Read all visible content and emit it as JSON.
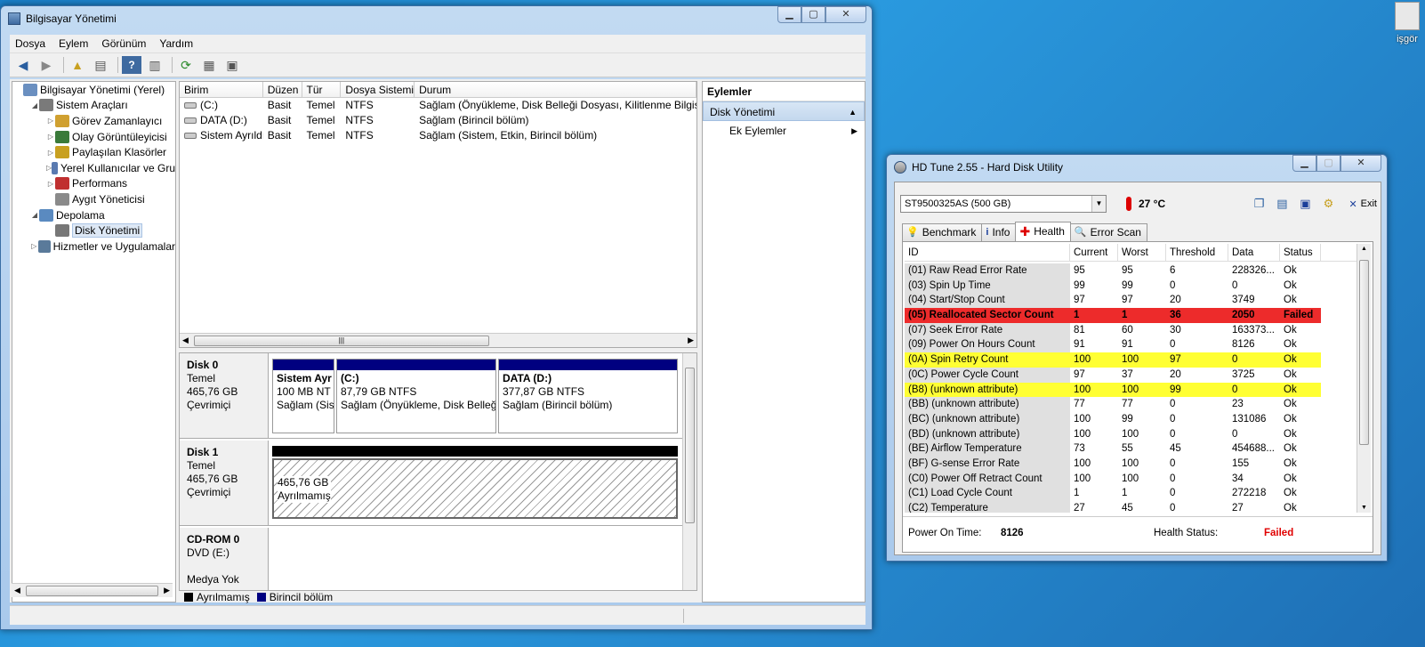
{
  "desktop": {
    "icon_label": "işgör"
  },
  "mmc": {
    "title": "Bilgisayar Yönetimi",
    "menu": [
      "Dosya",
      "Eylem",
      "Görünüm",
      "Yardım"
    ],
    "tree": [
      {
        "label": "Bilgisayar Yönetimi (Yerel)",
        "indent": 0,
        "exp": ""
      },
      {
        "label": "Sistem Araçları",
        "indent": 1,
        "exp": "◢"
      },
      {
        "label": "Görev Zamanlayıcı",
        "indent": 2,
        "exp": "▷"
      },
      {
        "label": "Olay Görüntüleyicisi",
        "indent": 2,
        "exp": "▷"
      },
      {
        "label": "Paylaşılan Klasörler",
        "indent": 2,
        "exp": "▷"
      },
      {
        "label": "Yerel Kullanıcılar ve Gru",
        "indent": 2,
        "exp": "▷"
      },
      {
        "label": "Performans",
        "indent": 2,
        "exp": "▷"
      },
      {
        "label": "Aygıt Yöneticisi",
        "indent": 2,
        "exp": ""
      },
      {
        "label": "Depolama",
        "indent": 1,
        "exp": "◢"
      },
      {
        "label": "Disk Yönetimi",
        "indent": 2,
        "exp": "",
        "selected": true
      },
      {
        "label": "Hizmetler ve Uygulamalar",
        "indent": 1,
        "exp": "▷"
      }
    ],
    "volume_headers": [
      "Birim",
      "Düzen",
      "Tür",
      "Dosya Sistemi",
      "Durum"
    ],
    "volumes": [
      [
        "(C:)",
        "Basit",
        "Temel",
        "NTFS",
        "Sağlam (Önyükleme, Disk Belleği Dosyası, Kilitlenme Bilgisi, I"
      ],
      [
        "DATA (D:)",
        "Basit",
        "Temel",
        "NTFS",
        "Sağlam (Birincil bölüm)"
      ],
      [
        "Sistem Ayrıldı",
        "Basit",
        "Temel",
        "NTFS",
        "Sağlam (Sistem, Etkin, Birincil bölüm)"
      ]
    ],
    "disk0": {
      "name": "Disk 0",
      "type": "Temel",
      "size": "465,76 GB",
      "status": "Çevrimiçi",
      "parts": [
        {
          "name": "Sistem Ayr",
          "size": "100 MB NT",
          "status": "Sağlam (Sis"
        },
        {
          "name": "(C:)",
          "size": "87,79 GB NTFS",
          "status": "Sağlam (Önyükleme, Disk Belleğ"
        },
        {
          "name": "DATA  (D:)",
          "size": "377,87 GB NTFS",
          "status": "Sağlam (Birincil bölüm)"
        }
      ]
    },
    "disk1": {
      "name": "Disk 1",
      "type": "Temel",
      "size": "465,76 GB",
      "status": "Çevrimiçi",
      "part_size": "465,76 GB",
      "part_status": "Ayrılmamış"
    },
    "cdrom": {
      "name": "CD-ROM 0",
      "type": "DVD (E:)",
      "status": "Medya Yok"
    },
    "legend": {
      "unallocated": "Ayrılmamış",
      "primary": "Birincil bölüm"
    },
    "actions": {
      "title": "Eylemler",
      "section": "Disk Yönetimi",
      "item": "Ek Eylemler"
    }
  },
  "hdtune": {
    "title": "HD Tune 2.55 - Hard Disk Utility",
    "drive": "ST9500325AS (500 GB)",
    "temperature": "27 °C",
    "exit": "Exit",
    "tabs": [
      "Benchmark",
      "Info",
      "Health",
      "Error Scan"
    ],
    "active_tab": "Health",
    "headers": [
      "ID",
      "Current",
      "Worst",
      "Threshold",
      "Data",
      "Status"
    ],
    "rows": [
      [
        "(01) Raw Read Error Rate",
        "95",
        "95",
        "6",
        "228326...",
        "Ok",
        ""
      ],
      [
        "(03) Spin Up Time",
        "99",
        "99",
        "0",
        "0",
        "Ok",
        ""
      ],
      [
        "(04) Start/Stop Count",
        "97",
        "97",
        "20",
        "3749",
        "Ok",
        ""
      ],
      [
        "(05) Reallocated Sector Count",
        "1",
        "1",
        "36",
        "2050",
        "Failed",
        "red"
      ],
      [
        "(07) Seek Error Rate",
        "81",
        "60",
        "30",
        "163373...",
        "Ok",
        ""
      ],
      [
        "(09) Power On Hours Count",
        "91",
        "91",
        "0",
        "8126",
        "Ok",
        ""
      ],
      [
        "(0A) Spin Retry Count",
        "100",
        "100",
        "97",
        "0",
        "Ok",
        "yellow"
      ],
      [
        "(0C) Power Cycle Count",
        "97",
        "37",
        "20",
        "3725",
        "Ok",
        ""
      ],
      [
        "(B8) (unknown attribute)",
        "100",
        "100",
        "99",
        "0",
        "Ok",
        "yellow"
      ],
      [
        "(BB) (unknown attribute)",
        "77",
        "77",
        "0",
        "23",
        "Ok",
        ""
      ],
      [
        "(BC) (unknown attribute)",
        "100",
        "99",
        "0",
        "131086",
        "Ok",
        ""
      ],
      [
        "(BD) (unknown attribute)",
        "100",
        "100",
        "0",
        "0",
        "Ok",
        ""
      ],
      [
        "(BE) Airflow Temperature",
        "73",
        "55",
        "45",
        "454688...",
        "Ok",
        ""
      ],
      [
        "(BF) G-sense Error Rate",
        "100",
        "100",
        "0",
        "155",
        "Ok",
        ""
      ],
      [
        "(C0) Power Off Retract Count",
        "100",
        "100",
        "0",
        "34",
        "Ok",
        ""
      ],
      [
        "(C1) Load Cycle Count",
        "1",
        "1",
        "0",
        "272218",
        "Ok",
        ""
      ],
      [
        "(C2) Temperature",
        "27",
        "45",
        "0",
        "27",
        "Ok",
        ""
      ]
    ],
    "footer": {
      "power_on_label": "Power On Time:",
      "power_on_value": "8126",
      "health_label": "Health Status:",
      "health_value": "Failed"
    },
    "colors": {
      "failed": "#ed2b2b",
      "warning": "#ffff33",
      "failed_text": "#e00000"
    }
  }
}
